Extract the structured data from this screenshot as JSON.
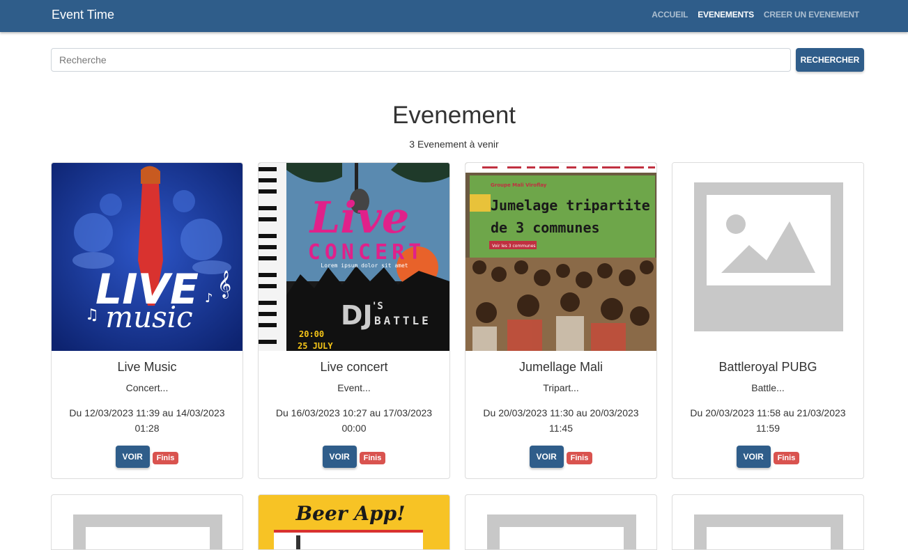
{
  "app": {
    "brand": "Event Time"
  },
  "nav": {
    "items": [
      {
        "label": "ACCUEIL",
        "active": false
      },
      {
        "label": "EVENEMENTS",
        "active": true
      },
      {
        "label": "CREER UN EVENEMENT",
        "active": false
      }
    ]
  },
  "search": {
    "placeholder": "Recherche",
    "value": "",
    "button_label": "RECHERCHER"
  },
  "page": {
    "title": "Evenement",
    "subtitle": "3 Evenement à venir"
  },
  "events": [
    {
      "title": "Live Music",
      "desc": "Concert...",
      "date": "Du 12/03/2023 11:39 au 14/03/2023 01:28",
      "button": "VOIR",
      "status": "Finis",
      "poster_text": [
        "LIVE",
        "music"
      ]
    },
    {
      "title": "Live concert",
      "desc": "Event...",
      "date": "Du 16/03/2023 10:27 au 17/03/2023 00:00",
      "button": "VOIR",
      "status": "Finis",
      "poster_text": [
        "Live",
        "CONCERT",
        "Lorem ipsum dolor sit amet",
        "DJ",
        "'S",
        "BATTLE",
        "20:00",
        "25 JULY"
      ]
    },
    {
      "title": "Jumellage Mali",
      "desc": "Tripart...",
      "date": "Du 20/03/2023 11:30 au 20/03/2023 11:45",
      "button": "VOIR",
      "status": "Finis",
      "poster_text": [
        "Groupe Mali Viroflay",
        "Jumelage tripartite",
        "de 3 communes",
        "Voir les 3 communes"
      ]
    },
    {
      "title": "Battleroyal PUBG",
      "desc": "Battle...",
      "date": "Du 20/03/2023 11:58 au 21/03/2023 11:59",
      "button": "VOIR",
      "status": "Finis",
      "poster_text": []
    }
  ],
  "next_row": [
    {
      "poster": "placeholder"
    },
    {
      "poster": "Beer App!"
    },
    {
      "poster": "placeholder"
    },
    {
      "poster": "placeholder"
    }
  ],
  "colors": {
    "primary": "#2f5d8a",
    "danger": "#d9534f"
  }
}
